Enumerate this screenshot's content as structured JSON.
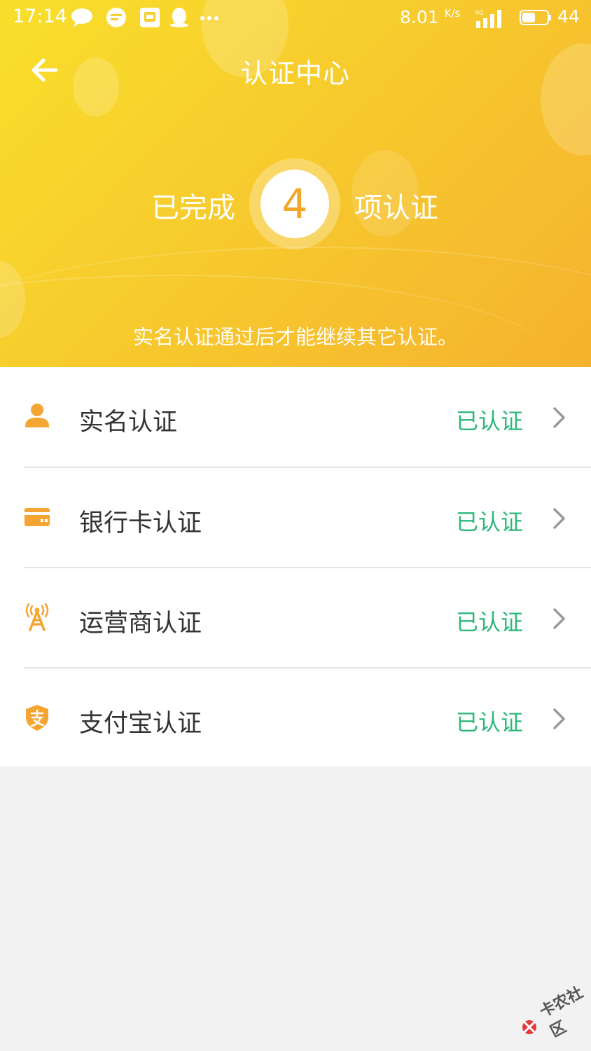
{
  "status_bar": {
    "time": "17:14",
    "net_speed": "8.01",
    "net_speed_unit": "K/s",
    "network_type": "4G",
    "battery_level": "44"
  },
  "header": {
    "title": "认证中心",
    "completed_prefix": "已完成",
    "completed_count": "4",
    "completed_suffix": "项认证",
    "notice": "实名认证通过后才能继续其它认证。"
  },
  "verifications": [
    {
      "label": "实名认证",
      "status": "已认证",
      "icon": "person-icon"
    },
    {
      "label": "银行卡认证",
      "status": "已认证",
      "icon": "bank-card-icon"
    },
    {
      "label": "运营商认证",
      "status": "已认证",
      "icon": "signal-tower-icon"
    },
    {
      "label": "支付宝认证",
      "status": "已认证",
      "icon": "alipay-shield-icon"
    }
  ],
  "colors": {
    "header_start": "#f9df2c",
    "header_end": "#f5b22e",
    "icon_orange": "#f5a532",
    "status_green": "#2cb77a",
    "count_orange": "#f2a72b"
  }
}
